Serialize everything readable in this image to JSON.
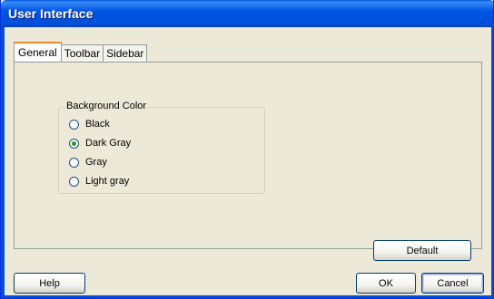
{
  "window": {
    "title": "User Interface"
  },
  "tabs": [
    {
      "label": "General",
      "active": true
    },
    {
      "label": "Toolbar",
      "active": false
    },
    {
      "label": "Sidebar",
      "active": false
    }
  ],
  "background_color_group": {
    "label": "Background Color",
    "options": [
      {
        "label": "Black",
        "selected": false
      },
      {
        "label": "Dark Gray",
        "selected": true
      },
      {
        "label": "Gray",
        "selected": false
      },
      {
        "label": "Light gray",
        "selected": false
      }
    ]
  },
  "buttons": {
    "default_label": "Default",
    "help_label": "Help",
    "ok_label": "OK",
    "cancel_label": "Cancel"
  },
  "colors": {
    "titlebar": "#0055e5",
    "dialog_background": "#ece9d8",
    "active_tab_accent": "#e68b2c",
    "radio_selected": "#21a121"
  }
}
